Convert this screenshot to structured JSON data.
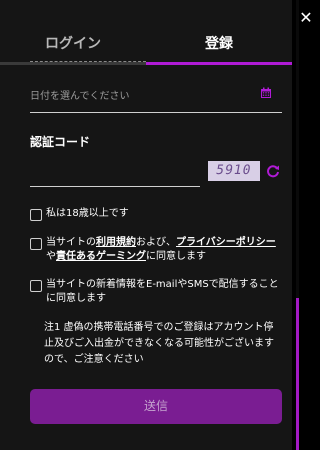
{
  "tabs": {
    "login": "ログイン",
    "register": "登録"
  },
  "date_field": {
    "placeholder": "日付を選んでください"
  },
  "captcha": {
    "label": "認証コード",
    "image_text": "5910"
  },
  "checks": {
    "age": "私は18歳以上です",
    "terms_pre": "当サイトの",
    "terms_link1": "利用規約",
    "terms_mid1": "および、",
    "terms_link2": "プライバシーポリシー",
    "terms_mid2": "や",
    "terms_link3": "責任あるゲーミング",
    "terms_post": "に同意します",
    "news": "当サイトの新着情報をE-mailやSMSで配信することに同意します"
  },
  "note": "注1 虚偽の携帯電話番号でのご登録はアカウント停止及びご入出金ができなくなる可能性がございますので、ご注意ください",
  "submit_label": "送信",
  "colors": {
    "accent": "#b01bd6",
    "button": "#7a1d92",
    "background": "#151515"
  },
  "icons": {
    "close": "close-icon",
    "calendar": "calendar-icon",
    "refresh": "refresh-icon"
  }
}
